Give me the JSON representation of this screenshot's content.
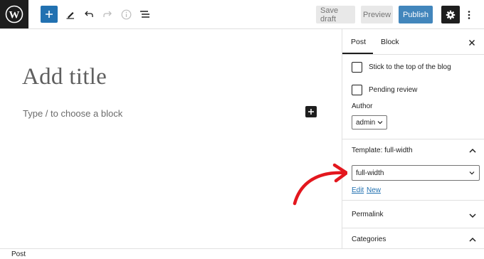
{
  "toolbar": {
    "save_draft": "Save draft",
    "preview": "Preview",
    "publish": "Publish",
    "accent": "#2271b1"
  },
  "editor": {
    "title_placeholder": "Add title",
    "block_placeholder": "Type / to choose a block"
  },
  "sidebar": {
    "tabs": [
      "Post",
      "Block"
    ],
    "active_tab": "Post",
    "sticky_label": "Stick to the top of the blog",
    "pending_label": "Pending review",
    "author_label": "Author",
    "author_value": "admin",
    "template_title": "Template: full-width",
    "template_value": "full-width",
    "template_edit": "Edit",
    "template_new": "New",
    "permalink_title": "Permalink",
    "categories_title": "Categories"
  },
  "statusbar": {
    "breadcrumb": "Post"
  },
  "annotation": {
    "color": "#e3171e"
  }
}
